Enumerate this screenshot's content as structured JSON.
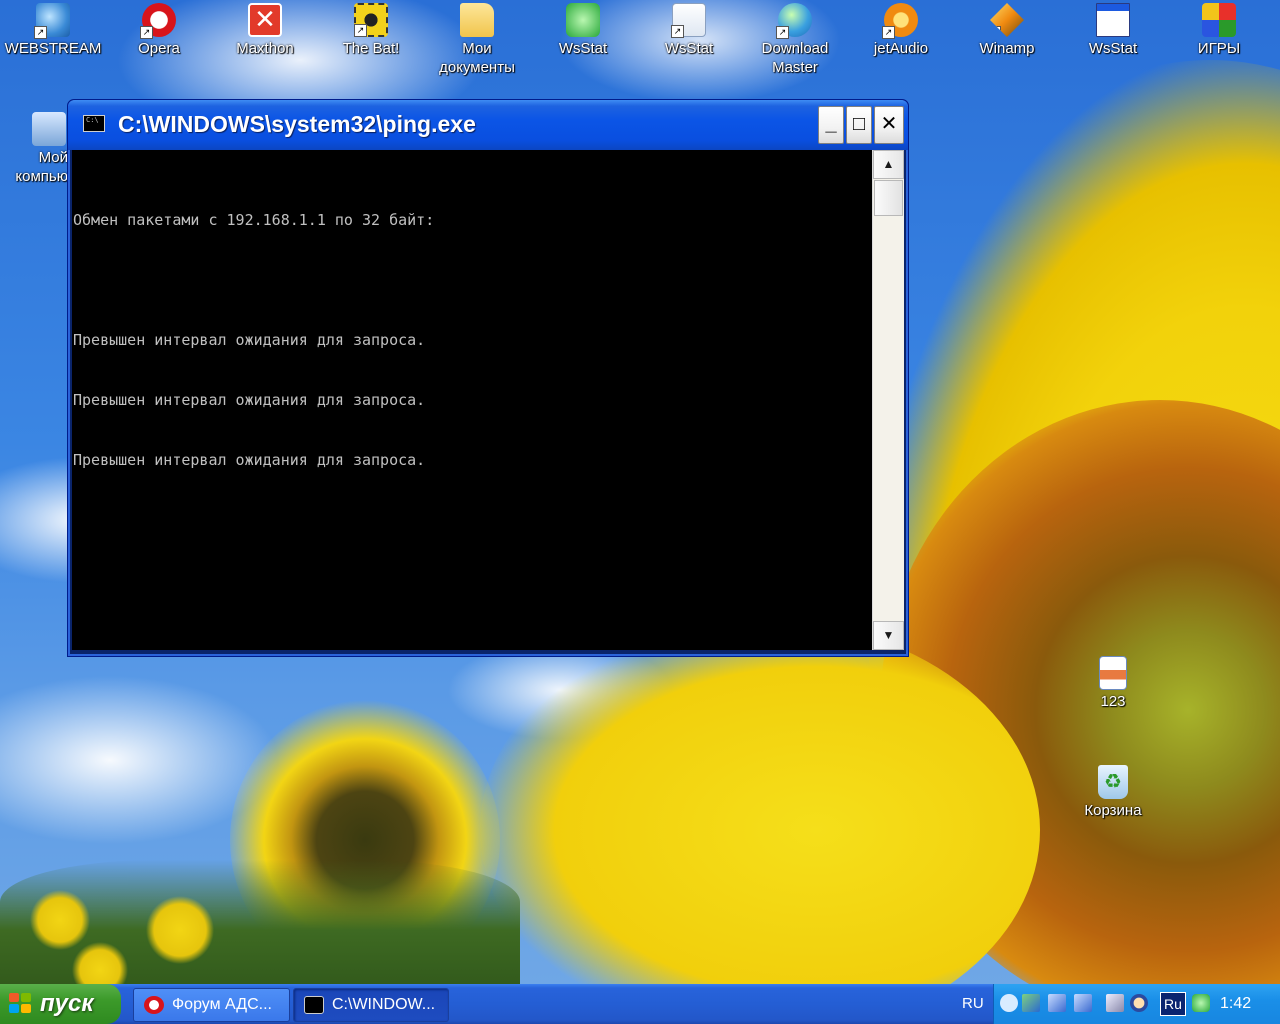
{
  "desktop": {
    "icons_top": [
      {
        "label": "WEBSTREAM",
        "icon": "network-globe-icon"
      },
      {
        "label": "Opera",
        "icon": "opera-icon"
      },
      {
        "label": "Maxthon",
        "icon": "maxthon-icon"
      },
      {
        "label": "The Bat!",
        "icon": "the-bat-icon"
      },
      {
        "label": "Мои документы",
        "icon": "folder-icon"
      },
      {
        "label": "WsStat",
        "icon": "wsstat-green-icon"
      },
      {
        "label": "WsStat",
        "icon": "wsstat-doc-icon"
      },
      {
        "label": "Download Master",
        "icon": "download-master-icon"
      },
      {
        "label": "jetAudio",
        "icon": "jetaudio-icon"
      },
      {
        "label": "Winamp",
        "icon": "winamp-icon"
      },
      {
        "label": "WsStat",
        "icon": "wsstat-window-icon"
      },
      {
        "label": "ИГРЫ",
        "icon": "games-icon"
      }
    ],
    "my_computer": {
      "label_line1": "Мой",
      "label_line2": "компью"
    },
    "file_123": {
      "label": "123"
    },
    "recycle_bin": {
      "label": "Корзина"
    }
  },
  "window": {
    "title": "C:\\WINDOWS\\system32\\ping.exe",
    "icon_text": "C:\\",
    "minimize_glyph": "_",
    "maximize_glyph": "□",
    "close_glyph": "✕",
    "console_lines": [
      "Обмен пакетами с 192.168.1.1 по 32 байт:",
      "",
      "Превышен интервал ожидания для запроса.",
      "Превышен интервал ожидания для запроса.",
      "Превышен интервал ожидания для запроса."
    ],
    "scroll_up_glyph": "▲",
    "scroll_down_glyph": "▼"
  },
  "taskbar": {
    "start_label": "пуск",
    "tasks": [
      {
        "label": "Форум АДС...",
        "icon": "opera-icon"
      },
      {
        "label": "C:\\WINDOW...",
        "icon": "console-icon"
      }
    ],
    "language": "RU",
    "tray_lang_badge": "Ru",
    "clock": "1:42"
  },
  "colors": {
    "title_bar": "#0b55e6",
    "console_bg": "#000000",
    "console_text": "#c0c0c0",
    "start_green": "#3c9a2a",
    "tray_blue": "#1a8fe8"
  }
}
